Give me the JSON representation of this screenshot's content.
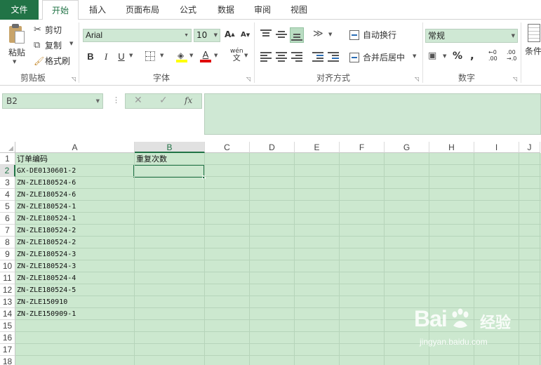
{
  "tabs": {
    "file": "文件",
    "home": "开始",
    "insert": "插入",
    "page_layout": "页面布局",
    "formulas": "公式",
    "data": "数据",
    "review": "审阅",
    "view": "视图"
  },
  "ribbon": {
    "clipboard": {
      "paste": "粘贴",
      "cut": "剪切",
      "copy": "复制",
      "format_painter": "格式刷",
      "group_label": "剪贴板"
    },
    "font": {
      "name": "Arial",
      "size": "10",
      "bold": "B",
      "italic": "I",
      "underline": "U",
      "font_color_letter": "A",
      "grow": "A",
      "shrink": "A",
      "phonetic_top": "wén",
      "phonetic_bottom": "文",
      "group_label": "字体",
      "fill_color": "#ffff00",
      "font_color": "#e00000"
    },
    "alignment": {
      "wrap_text": "自动换行",
      "merge_center": "合并后居中",
      "group_label": "对齐方式"
    },
    "number": {
      "format": "常规",
      "percent": "%",
      "comma": ",",
      "inc_decimal": "←0 .00",
      "dec_decimal": ".00 →.0",
      "group_label": "数字"
    },
    "styles": {
      "conditional_label": "条件"
    }
  },
  "formula_bar": {
    "name_box": "B2",
    "fx": "fx",
    "content": ""
  },
  "grid": {
    "columns": [
      "A",
      "B",
      "C",
      "D",
      "E",
      "F",
      "G",
      "H",
      "I",
      "J"
    ],
    "rows": [
      "1",
      "2",
      "3",
      "4",
      "5",
      "6",
      "7",
      "8",
      "9",
      "10",
      "11",
      "12",
      "13",
      "14",
      "15",
      "16",
      "17",
      "18"
    ],
    "active_cell": "B2",
    "header_a1": "订单编码",
    "header_b1": "重复次数",
    "order_codes": [
      "GX-DE0130601-2",
      "ZN-ZLE180524-6",
      "ZN-ZLE180524-6",
      "ZN-ZLE180524-1",
      "ZN-ZLE180524-1",
      "ZN-ZLE180524-2",
      "ZN-ZLE180524-2",
      "ZN-ZLE180524-3",
      "ZN-ZLE180524-3",
      "ZN-ZLE180524-4",
      "ZN-ZLE180524-5",
      "ZN-ZLE150910",
      "ZN-ZLE150909-1"
    ]
  },
  "watermark": {
    "logo": "Bai",
    "logo_suffix": "经验",
    "url": "jingyan.baidu.com"
  },
  "colors": {
    "accent": "#217346",
    "grid_fill": "#cce8cf",
    "field_fill": "#cfe8d4"
  }
}
